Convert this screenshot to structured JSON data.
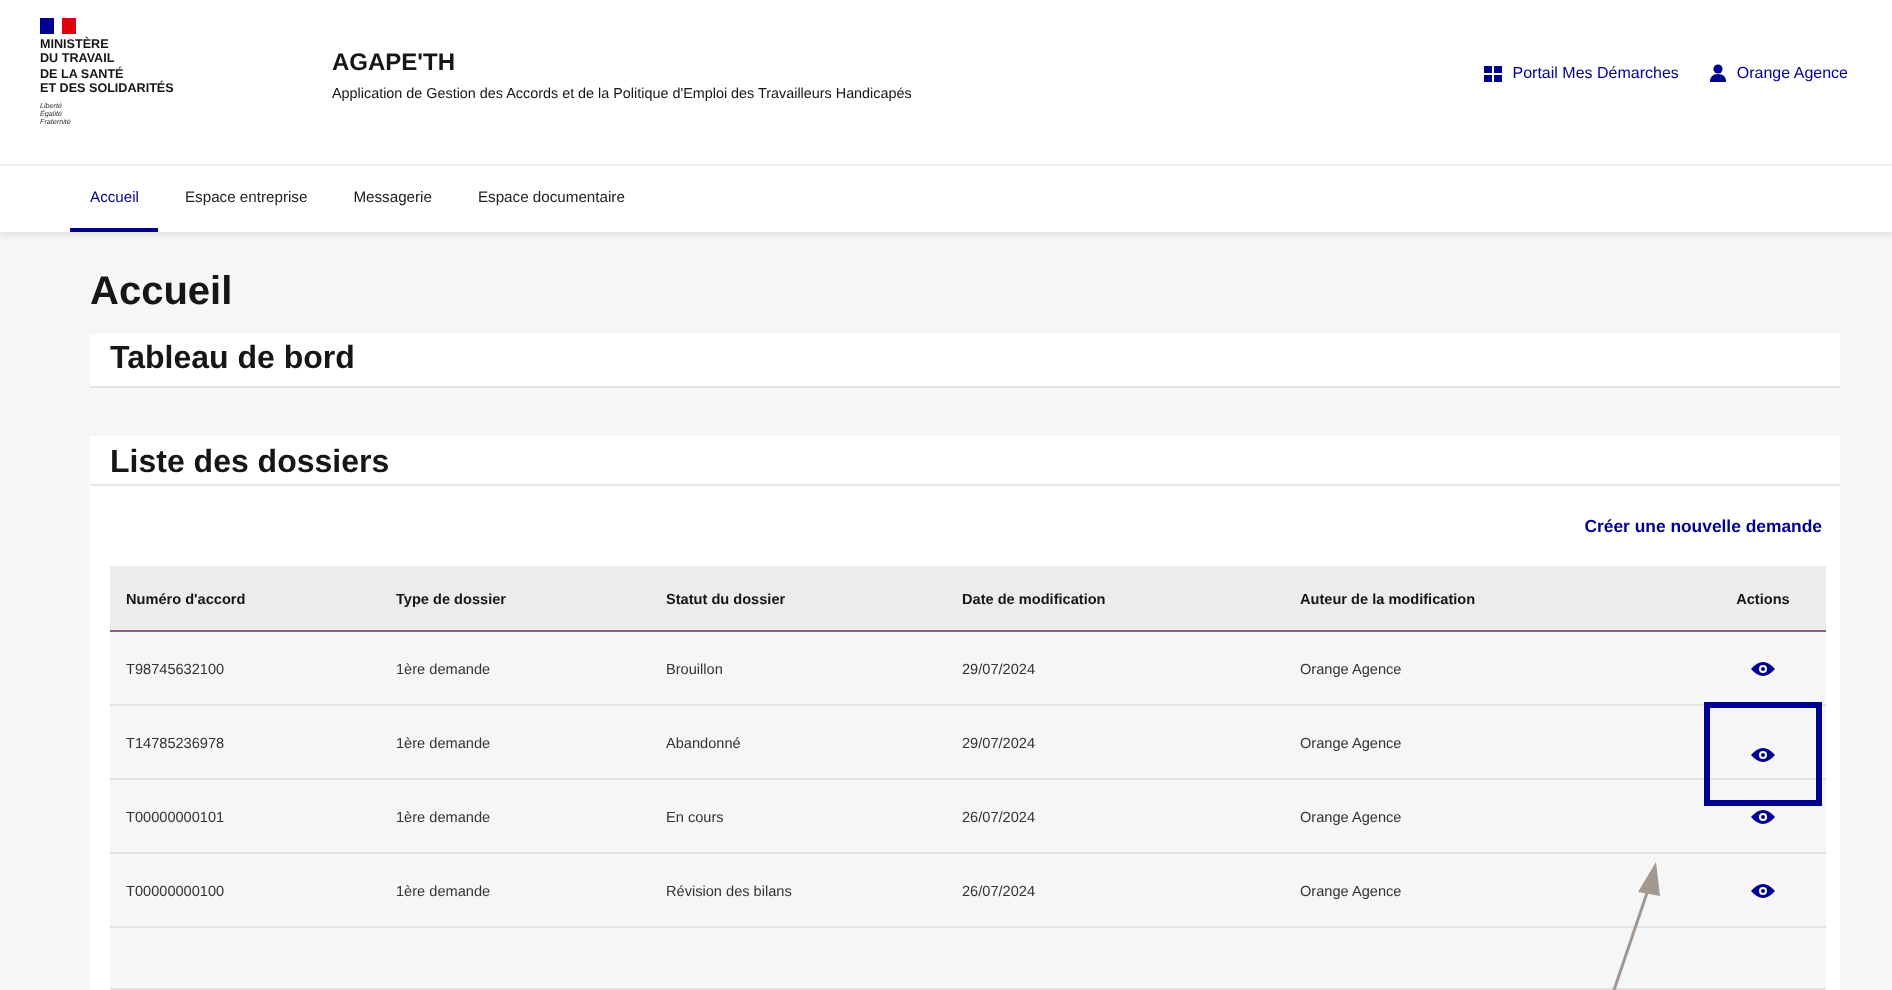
{
  "header": {
    "ministry": [
      "MINISTÈRE",
      "DU TRAVAIL",
      "DE LA SANTÉ",
      "ET DES SOLIDARITÉS"
    ],
    "motto": [
      "Liberté",
      "Égalité",
      "Fraternité"
    ],
    "app_name": "AGAPE'TH",
    "app_subtitle": "Application de Gestion des Accords et de la Politique d'Emploi des Travailleurs Handicapés",
    "links": [
      {
        "kind": "portal",
        "label": "Portail Mes Démarches"
      },
      {
        "kind": "user",
        "label": "Orange Agence"
      }
    ]
  },
  "tabs": [
    {
      "label": "Accueil",
      "selected": true
    },
    {
      "label": "Espace entreprise",
      "selected": false
    },
    {
      "label": "Messagerie",
      "selected": false
    },
    {
      "label": "Espace documentaire",
      "selected": false
    }
  ],
  "page_title": "Accueil",
  "dashboard_title": "Tableau de bord",
  "list_title": "Liste des dossiers",
  "create_link": "Créer une nouvelle demande",
  "table": {
    "columns": [
      "Numéro d'accord",
      "Type de dossier",
      "Statut du dossier",
      "Date de modification",
      "Auteur de la modification",
      "Actions"
    ],
    "rows": [
      {
        "cells": [
          "T98745632100",
          "1ère demande",
          "Brouillon",
          "29/07/2024",
          "Orange Agence"
        ],
        "highlighted": false
      },
      {
        "cells": [
          "T14785236978",
          "1ère demande",
          "Abandonné",
          "29/07/2024",
          "Orange Agence"
        ],
        "highlighted": true
      },
      {
        "cells": [
          "T00000000101",
          "1ère demande",
          "En cours",
          "26/07/2024",
          "Orange Agence"
        ],
        "highlighted": false
      },
      {
        "cells": [
          "T00000000100",
          "1ère demande",
          "Révision des bilans",
          "26/07/2024",
          "Orange Agence"
        ],
        "highlighted": false
      }
    ]
  }
}
